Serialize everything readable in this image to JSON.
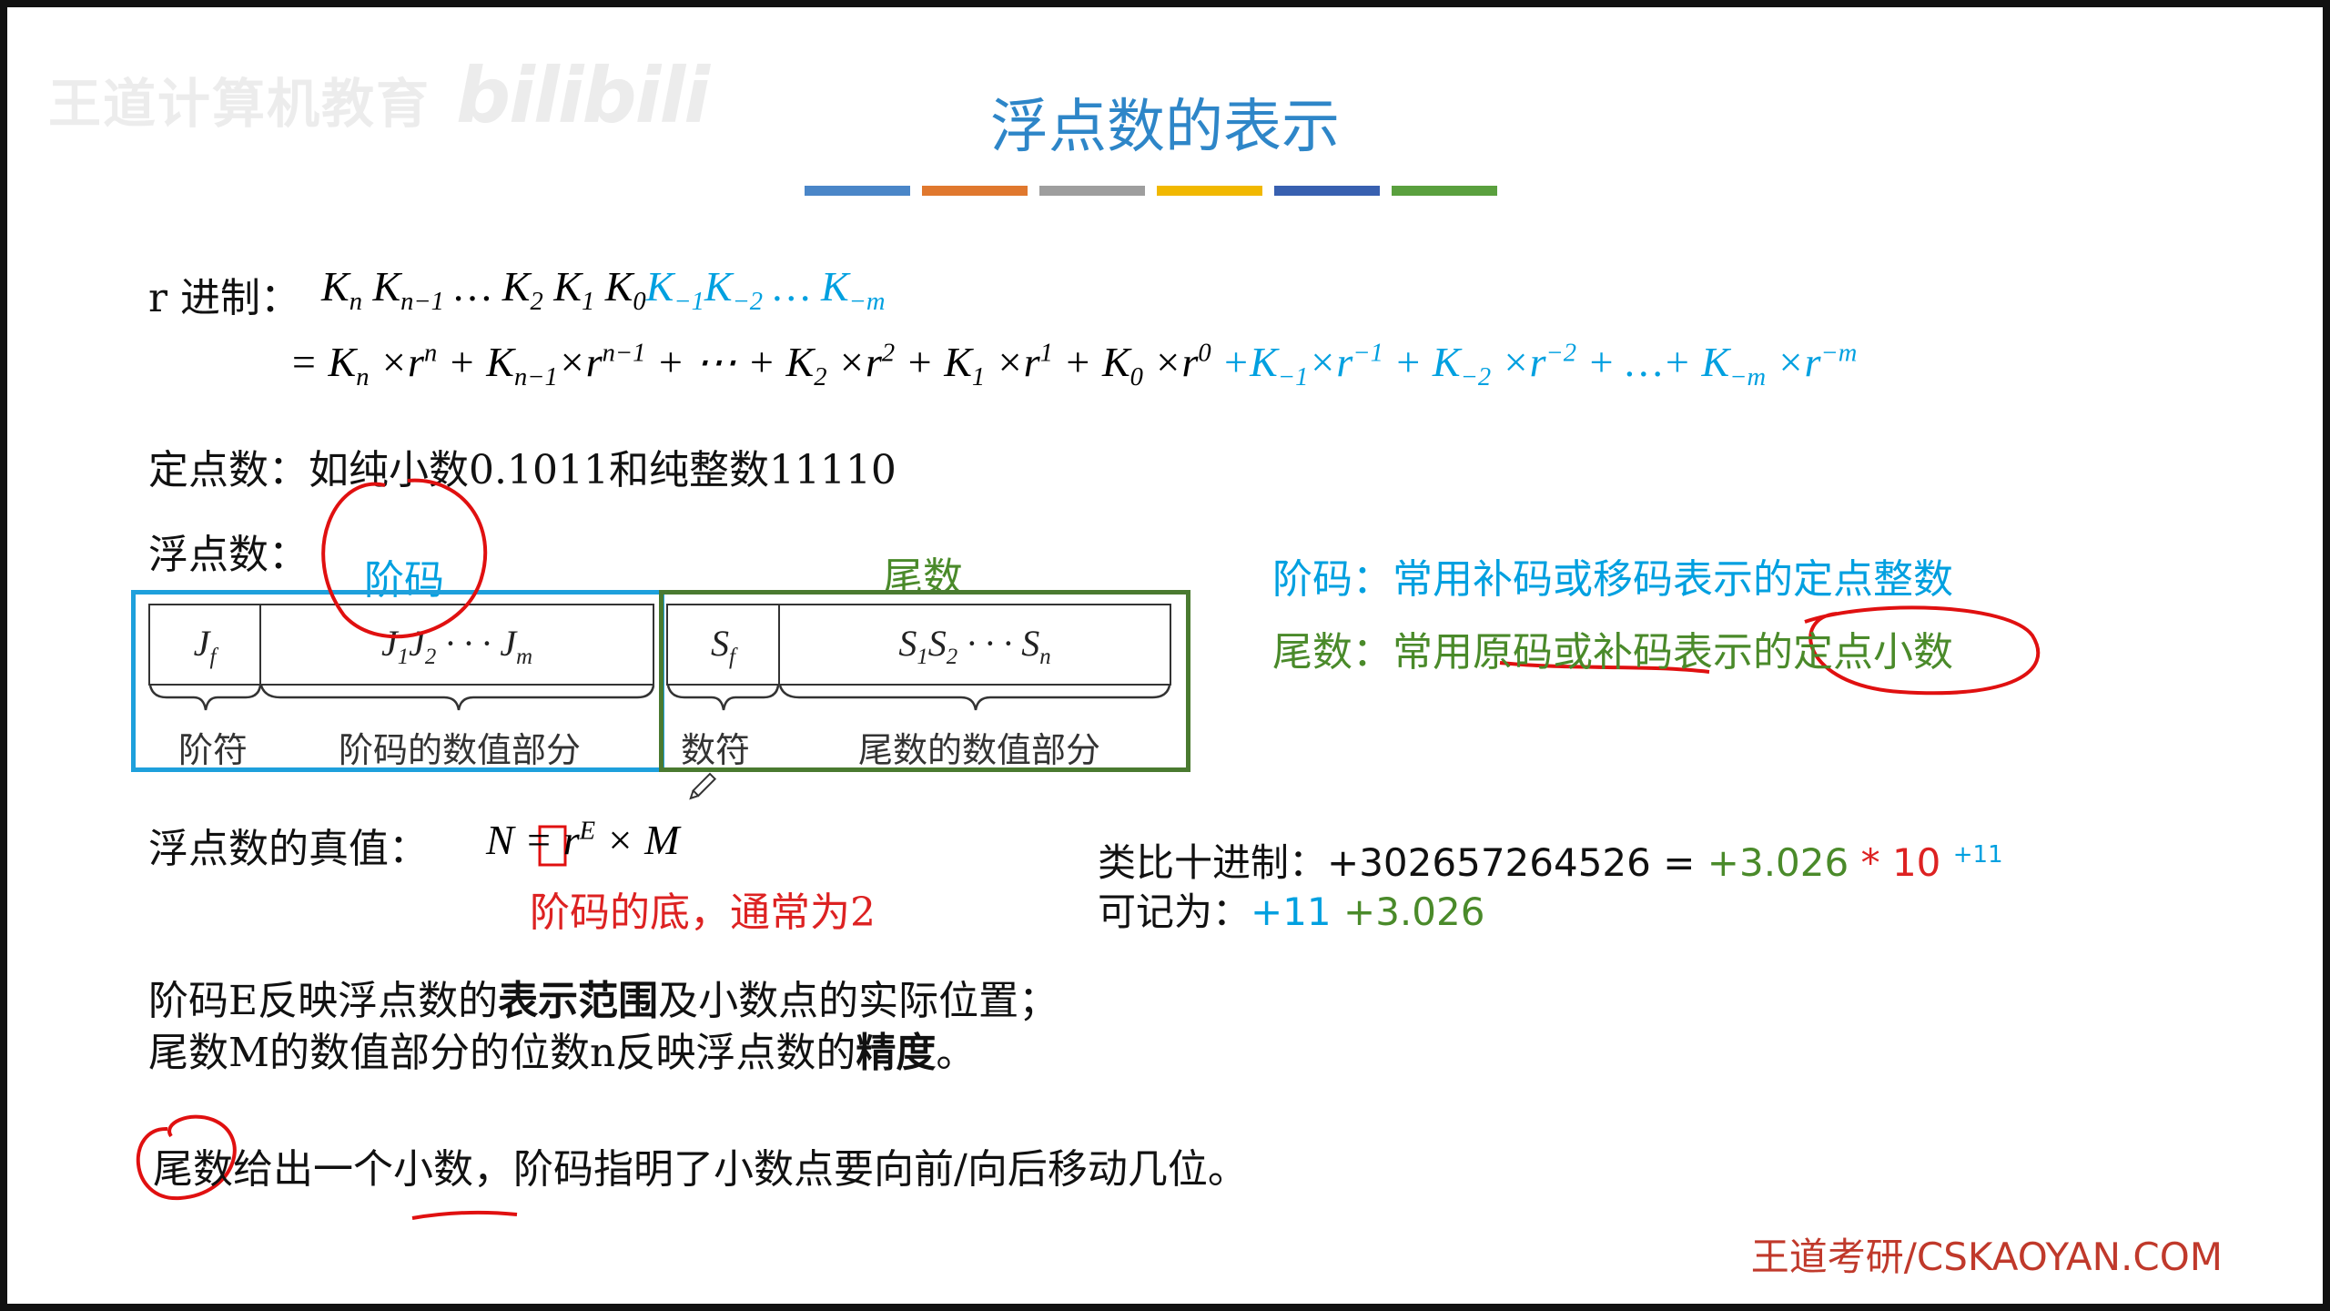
{
  "watermark": {
    "org": "王道计算机教育",
    "logo": "bilibili"
  },
  "title": "浮点数的表示",
  "accent_bars": [
    "#4a86c8",
    "#e0782e",
    "#9e9e9e",
    "#f1b800",
    "#3860b0",
    "#5aa03e"
  ],
  "radix": {
    "label": "r 进制：",
    "digits_int": "Kn Kn−1 … K2 K1 K0",
    "digits_frac": "K−1K−2 … K−m",
    "expansion_int": "= Kn ×r^n + Kn−1×r^(n−1) + ⋯ + K2 ×r^2 + K1 ×r^1 + K0 ×r^0",
    "expansion_frac": "+K−1×r^−1 + K−2 ×r^−2 + …+ K−m ×r^−m"
  },
  "fixed_point": {
    "label": "定点数：",
    "text": "如纯小数0.1011和纯整数11110"
  },
  "floating": {
    "label": "浮点数：",
    "exponent_title": "阶码",
    "mantissa_title": "尾数",
    "cells": {
      "jf": "Jf",
      "jvals": "J1J2 · · · Jm",
      "sf": "Sf",
      "svals": "S1S2 · · · Sn"
    },
    "labels": {
      "jie_fu": "阶符",
      "jie_vals": "阶码的数值部分",
      "shu_fu": "数符",
      "wei_vals": "尾数的数值部分"
    },
    "note_exponent": "阶码：常用补码或移码表示的定点整数",
    "note_mantissa": "尾数：常用原码或补码表示的定点小数"
  },
  "true_value": {
    "label": "浮点数的真值：",
    "formula": "N = r^E × M",
    "base_note": "阶码的底，通常为2"
  },
  "decimal_example": {
    "label": "类比十进制：",
    "number": "+302657264526",
    "eq": "=",
    "mant": "+3.026",
    "times": "*",
    "base": "10",
    "exp": "+11",
    "record_label": "可记为：",
    "record_exp": "+11",
    "record_mant": "+3.026"
  },
  "explain": {
    "line1_a": "阶码E反映浮点数的",
    "line1_b": "表示范围",
    "line1_c": "及小数点的实际位置；",
    "line2_a": "尾数M的数值部分的位数n反映浮点数的",
    "line2_b": "精度",
    "line2_c": "。"
  },
  "summary": "尾数给出一个小数，阶码指明了小数点要向前/向后移动几位。",
  "footer": "王道考研/CSKAOYAN.COM"
}
